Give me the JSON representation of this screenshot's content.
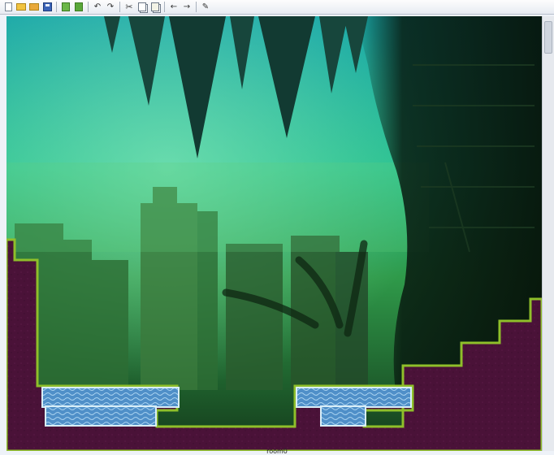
{
  "toolbar": {
    "buttons": [
      {
        "id": "new",
        "icon": "new-document-icon"
      },
      {
        "id": "open",
        "icon": "open-folder-icon"
      },
      {
        "id": "open-recent",
        "icon": "open-recent-icon"
      },
      {
        "id": "save",
        "icon": "floppy-save-icon"
      },
      {
        "id": "export",
        "icon": "export-icon"
      },
      {
        "id": "import",
        "icon": "import-icon"
      },
      {
        "id": "undo",
        "icon": "undo-icon",
        "glyph": "↶"
      },
      {
        "id": "redo",
        "icon": "redo-icon",
        "glyph": "↷"
      },
      {
        "id": "cut",
        "icon": "cut-icon",
        "glyph": "✂"
      },
      {
        "id": "copy",
        "icon": "copy-icon"
      },
      {
        "id": "paste",
        "icon": "paste-icon"
      },
      {
        "id": "back",
        "icon": "arrow-left-icon",
        "glyph": "←"
      },
      {
        "id": "forward",
        "icon": "arrow-right-icon",
        "glyph": "→"
      },
      {
        "id": "pencil",
        "icon": "pencil-icon",
        "glyph": "✎"
      }
    ]
  },
  "status": {
    "label": "room0"
  },
  "colors": {
    "ground": "#4a1238",
    "grass": "#8fbf2a",
    "water": "#4f8fc8",
    "sky_top": "#2bb3b3",
    "fog": "#3aa05a"
  }
}
